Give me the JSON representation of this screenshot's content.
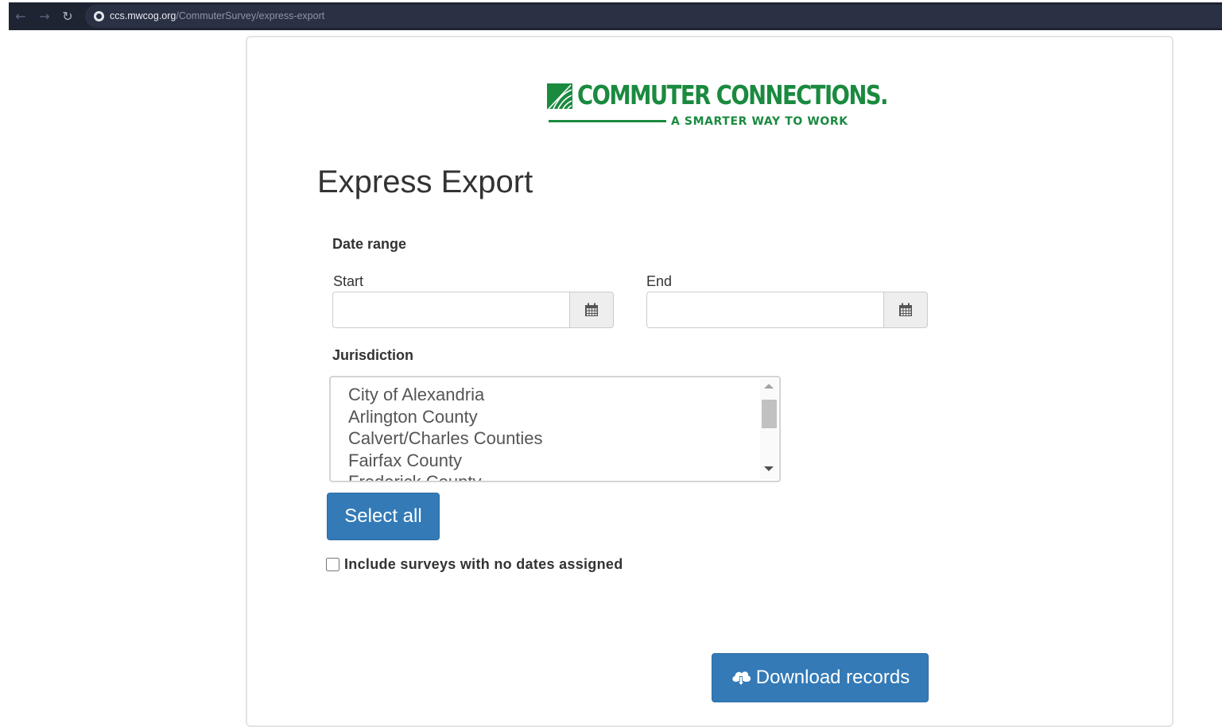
{
  "browser": {
    "url_host": "ccs.mwcog.org",
    "url_path": "/CommuterSurvey/express-export"
  },
  "brand": {
    "name": "COMMUTER CONNECTIONS.",
    "tagline": "A SMARTER WAY TO WORK",
    "color": "#1a8a3f"
  },
  "page": {
    "title": "Express Export"
  },
  "date_range": {
    "label": "Date range",
    "start_label": "Start",
    "start_value": "",
    "end_label": "End",
    "end_value": ""
  },
  "jurisdiction": {
    "label": "Jurisdiction",
    "options": [
      "City of Alexandria",
      "Arlington County",
      "Calvert/Charles Counties",
      "Fairfax County",
      "Frederick County"
    ]
  },
  "actions": {
    "select_all_label": "Select all",
    "include_undated_label": "Include surveys with no dates assigned",
    "download_label": "Download records",
    "primary_color": "#337ab7"
  }
}
